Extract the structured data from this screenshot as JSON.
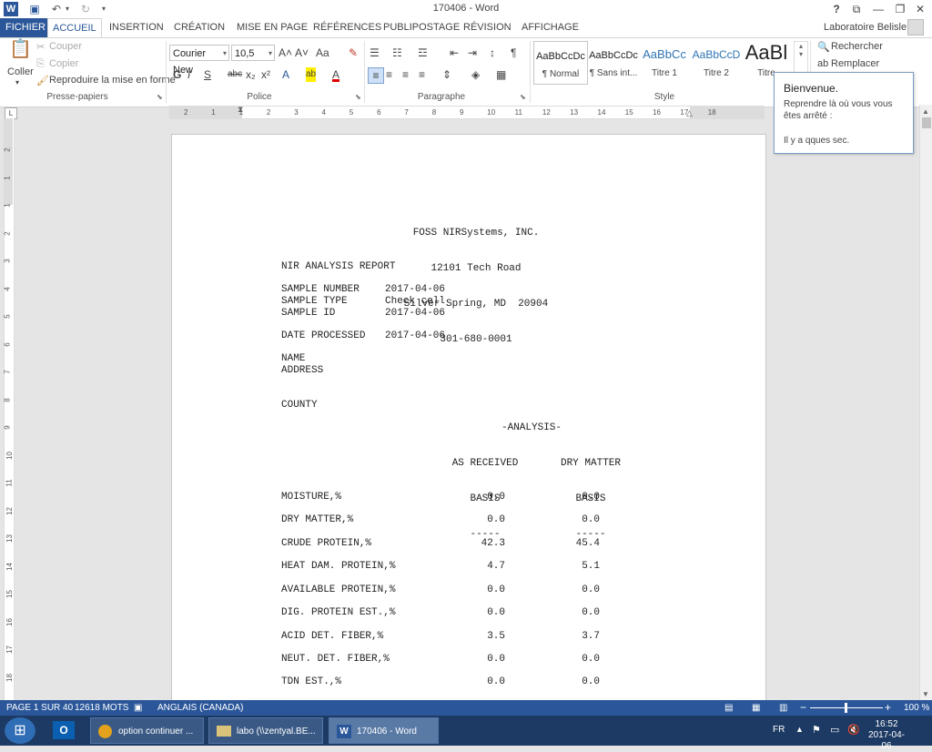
{
  "window": {
    "title": "170406 - Word",
    "help": "?",
    "minimize": "—",
    "restore": "❐",
    "close": "✕"
  },
  "quick_access": {
    "word": "W",
    "save": "💾",
    "undo": "↶",
    "redo": "↻",
    "more": "▾"
  },
  "user": {
    "name": "Laboratoire Belisle",
    "dropdown": "▾"
  },
  "tabs": [
    {
      "label": "FICHIER"
    },
    {
      "label": "ACCUEIL"
    },
    {
      "label": "INSERTION"
    },
    {
      "label": "CRÉATION"
    },
    {
      "label": "MISE EN PAGE"
    },
    {
      "label": "RÉFÉRENCES"
    },
    {
      "label": "PUBLIPOSTAGE"
    },
    {
      "label": "RÉVISION"
    },
    {
      "label": "AFFICHAGE"
    }
  ],
  "clipboard": {
    "paste": "Coller",
    "cut": "Couper",
    "copy": "Copier",
    "format_painter": "Reproduire la mise en forme",
    "group": "Presse-papiers"
  },
  "font": {
    "family": "Courier New",
    "size": "10,5",
    "grow": "A˄",
    "shrink": "A˅",
    "case": "Aa",
    "clear": "✎",
    "bold": "G",
    "italic": "I",
    "underline": "S",
    "strike": "abc",
    "subscript": "x₂",
    "superscript": "x²",
    "effects": "A",
    "highlight": "ab",
    "color": "A",
    "group": "Police"
  },
  "paragraph": {
    "group": "Paragraphe",
    "show_marks": "¶",
    "sort": "↕"
  },
  "styles": {
    "group": "Style",
    "items": [
      {
        "sample": "AaBbCcDc",
        "name": "¶ Normal"
      },
      {
        "sample": "AaBbCcDc",
        "name": "¶ Sans int..."
      },
      {
        "sample": "AaBbCc",
        "name": "Titre 1"
      },
      {
        "sample": "AaBbCcD",
        "name": "Titre 2"
      },
      {
        "sample": "AaBl",
        "name": "Titre"
      }
    ]
  },
  "editing": {
    "find": "Rechercher",
    "replace": "Remplacer"
  },
  "ruler": {
    "ticks": [
      "2",
      "1",
      "1",
      "2",
      "3",
      "4",
      "5",
      "6",
      "7",
      "8",
      "9",
      "10",
      "11",
      "12",
      "13",
      "14",
      "15",
      "16",
      "17",
      "18"
    ]
  },
  "vruler": {
    "ticks": [
      "2",
      "1",
      "1",
      "2",
      "3",
      "4",
      "5",
      "6",
      "7",
      "8",
      "9",
      "10",
      "11",
      "12",
      "13",
      "14",
      "15",
      "16",
      "17",
      "18"
    ]
  },
  "popup": {
    "title": "Bienvenue.",
    "line1": "Reprendre là où vous vous êtes arrêté :",
    "line2": "Il y a qques sec."
  },
  "document": {
    "header": [
      "FOSS NIRSystems, INC.",
      "12101 Tech Road",
      "Silver Spring, MD  20904",
      "301-680-0001"
    ],
    "report_title": "NIR ANALYSIS REPORT",
    "fields": [
      {
        "label": "SAMPLE NUMBER",
        "value": "2017-04-06"
      },
      {
        "label": "SAMPLE TYPE",
        "value": "Check cell"
      },
      {
        "label": "SAMPLE ID",
        "value": "2017-04-06"
      }
    ],
    "date_processed_label": "DATE PROCESSED",
    "date_processed_value": "2017-04-06",
    "name_label": "NAME",
    "address_label": "ADDRESS",
    "county_label": "COUNTY",
    "analysis_title": "-ANALYSIS-",
    "col1": [
      "AS RECEIVED",
      "BASIS",
      "-----"
    ],
    "col2": [
      "DRY MATTER",
      "BASIS",
      "-----"
    ],
    "rows": [
      {
        "label": "MOISTURE,%",
        "received": "0.0",
        "dry": "0.0"
      },
      {
        "label": "DRY MATTER,%",
        "received": "0.0",
        "dry": "0.0"
      },
      {
        "label": "CRUDE PROTEIN,%",
        "received": "42.3",
        "dry": "45.4"
      },
      {
        "label": "HEAT DAM. PROTEIN,%",
        "received": "4.7",
        "dry": "5.1"
      },
      {
        "label": "AVAILABLE PROTEIN,%",
        "received": "0.0",
        "dry": "0.0"
      },
      {
        "label": "DIG. PROTEIN EST.,%",
        "received": "0.0",
        "dry": "0.0"
      },
      {
        "label": "ACID DET. FIBER,%",
        "received": "3.5",
        "dry": "3.7"
      },
      {
        "label": "NEUT. DET. FIBER,%",
        "received": "0.0",
        "dry": "0.0"
      },
      {
        "label": "TDN EST.,%",
        "received": "0.0",
        "dry": "0.0"
      }
    ]
  },
  "status": {
    "page": "PAGE 1 SUR 40",
    "words": "12618 MOTS",
    "language": "ANGLAIS (CANADA)",
    "zoom": "100 %",
    "zoom_minus": "−",
    "zoom_plus": "+"
  },
  "taskbar": {
    "start": "⊞",
    "items": [
      {
        "label": "option continuer ..."
      },
      {
        "label": "labo (\\\\zentyal.BE..."
      },
      {
        "label": "170406 - Word"
      }
    ],
    "lang": "FR",
    "time": "16:52",
    "date": "2017-04-06"
  },
  "colors": {
    "accent": "#2b579a",
    "taskbar": "#1c3a63"
  }
}
